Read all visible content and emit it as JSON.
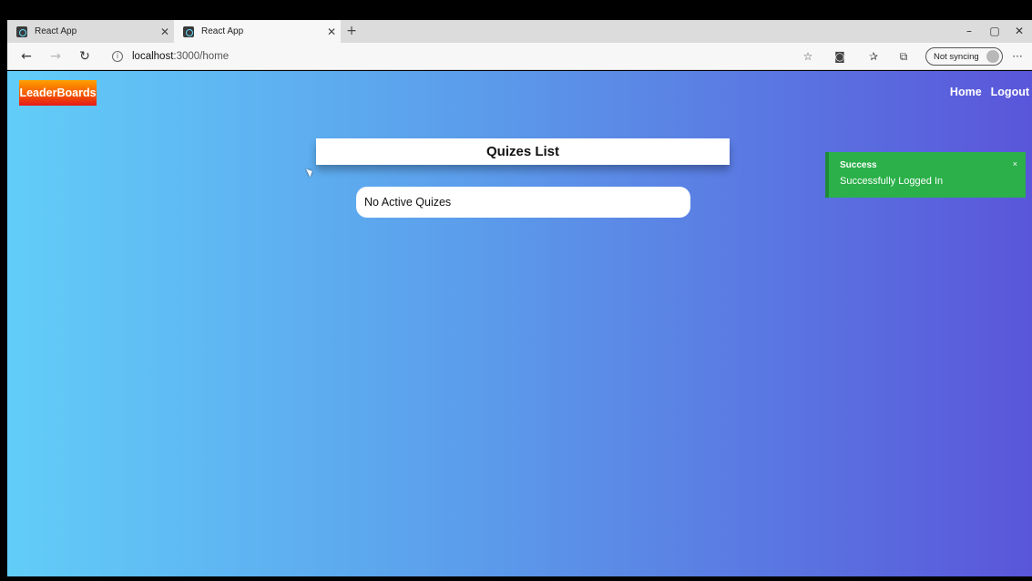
{
  "browser": {
    "tabs": [
      {
        "title": "React App",
        "active": false
      },
      {
        "title": "React App",
        "active": true
      }
    ],
    "new_tab": "+",
    "window_controls": {
      "minimize": "–",
      "maximize": "▢",
      "close": "✕"
    },
    "nav": {
      "back": "←",
      "forward": "→",
      "reload": "↻"
    },
    "url": {
      "host": "localhost",
      "path": ":3000/home"
    },
    "sync_label": "Not syncing",
    "more": "···"
  },
  "page": {
    "brand": "LeaderBoards",
    "nav_links": [
      "Home",
      "Logout"
    ],
    "list_title": "Quizes List",
    "empty_message": "No Active Quizes"
  },
  "toast": {
    "title": "Success",
    "message": "Successfully Logged In",
    "close": "×"
  },
  "colors": {
    "gradient_start": "#62cdf8",
    "gradient_end": "#5a56da",
    "toast": "#2bb04a",
    "brand_top": "#ffa000",
    "brand_bottom": "#e41a1a"
  }
}
